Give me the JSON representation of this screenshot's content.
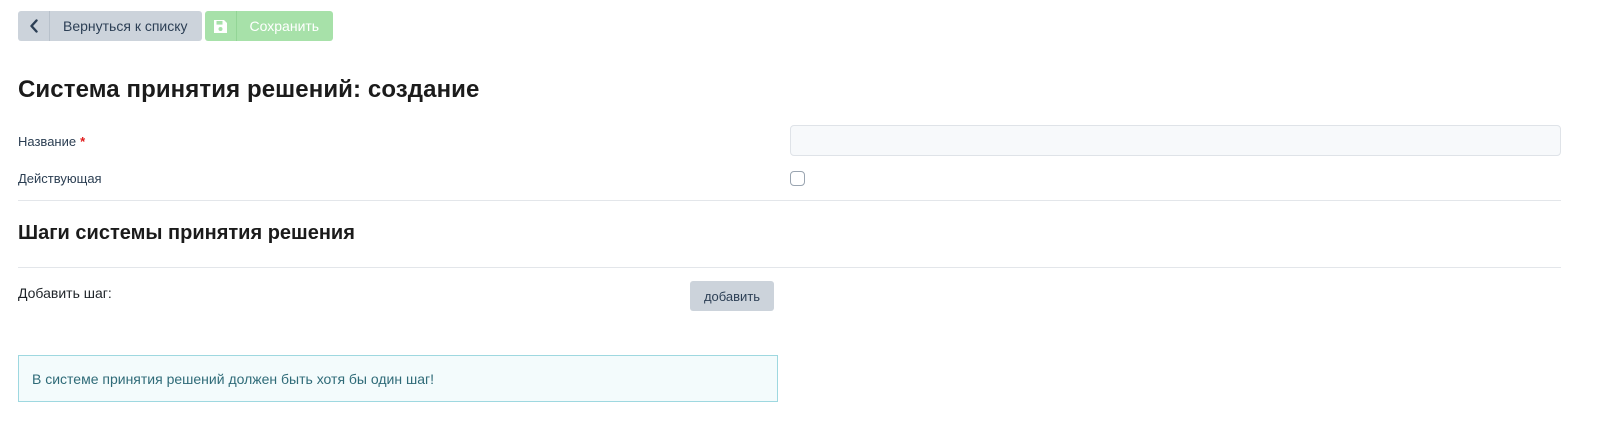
{
  "toolbar": {
    "back_icon": "chevron-left-icon",
    "back_label": "Вернуться к списку",
    "save_icon": "floppy-disk-icon",
    "save_label": "Сохранить"
  },
  "page": {
    "title": "Система принятия решений: создание"
  },
  "form": {
    "name_label": "Название",
    "name_required_mark": "*",
    "name_value": "",
    "active_label": "Действующая",
    "active_checked": false
  },
  "steps": {
    "title": "Шаги системы принятия решения",
    "add_label": "Добавить шаг:",
    "add_button": "добавить",
    "alert": "В системе принятия решений должен быть хотя бы один шаг!"
  },
  "colors": {
    "back_button_bg": "#ccd3db",
    "save_button_bg": "#a7e1a9",
    "required": "#e01b1b",
    "alert_bg": "#f3fbfc",
    "alert_border": "#9ed8e0",
    "alert_text": "#2f6b78"
  }
}
